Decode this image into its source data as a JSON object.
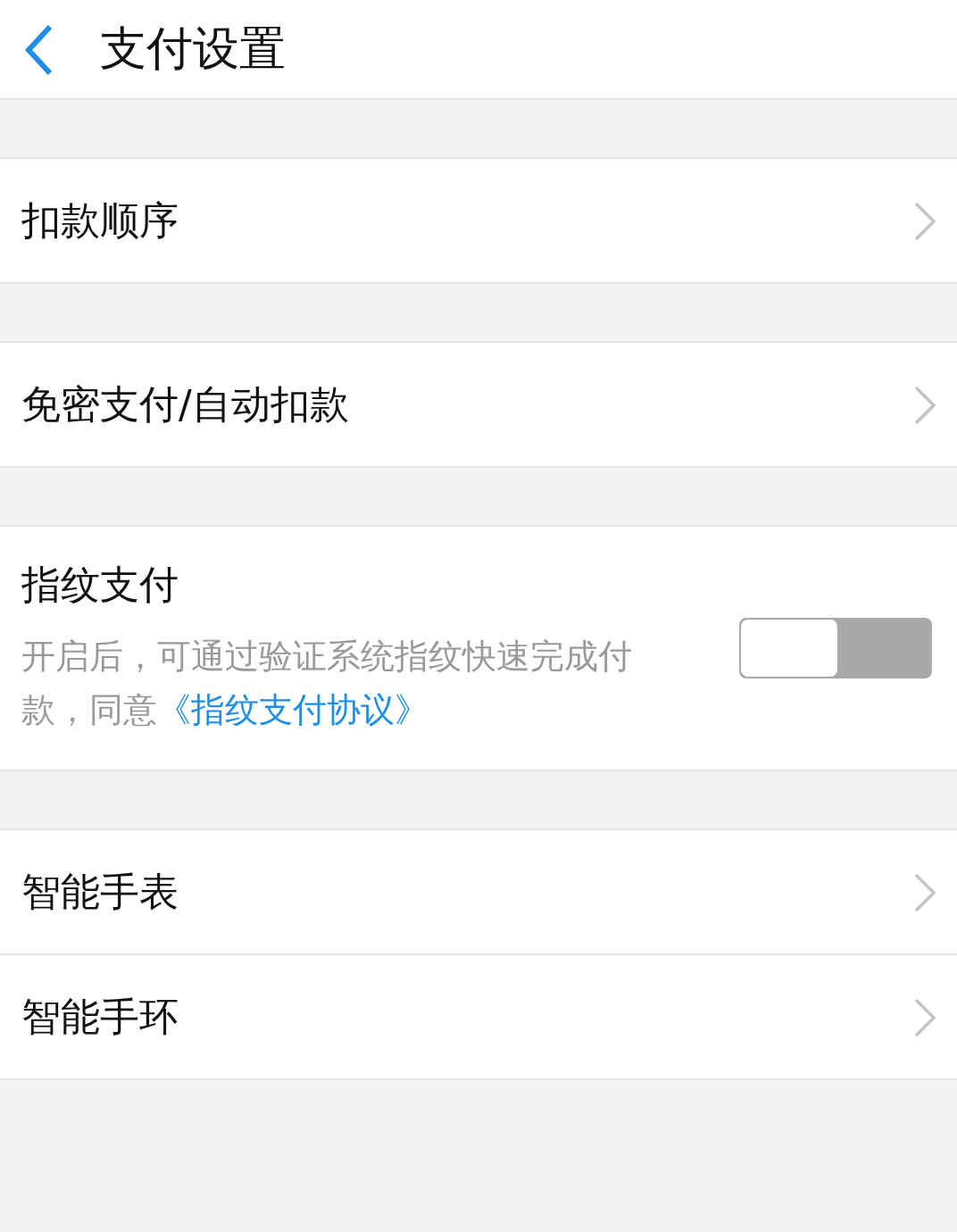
{
  "header": {
    "title": "支付设置"
  },
  "sections": [
    {
      "items": [
        {
          "kind": "link",
          "label": "扣款顺序"
        }
      ]
    },
    {
      "items": [
        {
          "kind": "link",
          "label": "免密支付/自动扣款"
        }
      ]
    },
    {
      "items": [
        {
          "kind": "toggle",
          "label": "指纹支付",
          "description": "开启后，可通过验证系统指纹快速完成付款，同意",
          "link": "《指纹支付协议》",
          "on": false
        }
      ]
    },
    {
      "items": [
        {
          "kind": "link",
          "label": "智能手表"
        },
        {
          "kind": "link",
          "label": "智能手环"
        }
      ]
    }
  ]
}
